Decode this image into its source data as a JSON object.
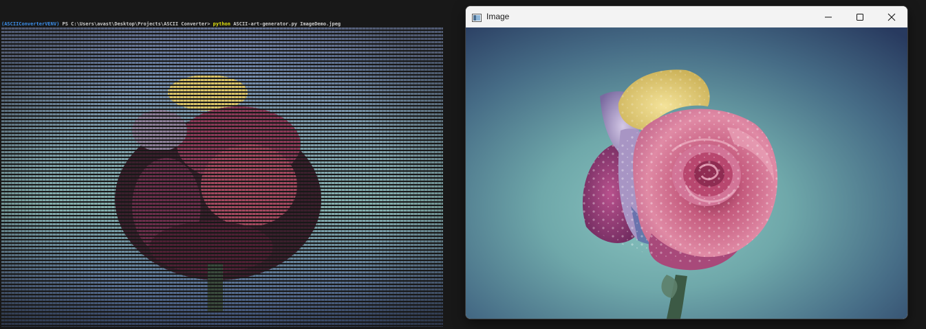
{
  "terminal": {
    "venv": "(ASCIIConverterVENV)",
    "path": "PS C:\\Users\\avast\\Desktop\\Projects\\ASCII Converter>",
    "command": "python",
    "args": "ASCII-art-generator.py ImageDemo.jpeg"
  },
  "image_window": {
    "title": "Image",
    "icon": "image-window-icon",
    "controls": {
      "minimize": "minimize-icon",
      "maximize": "maximize-icon",
      "close": "close-icon"
    }
  },
  "colors": {
    "terminal_bg": "#181818",
    "titlebar_bg": "#f3f3f3",
    "venv_text": "#3b8eea",
    "python_text": "#e5e510",
    "photo_bg_center": "#7fb9b8",
    "photo_bg_edge": "#2c3f63"
  }
}
